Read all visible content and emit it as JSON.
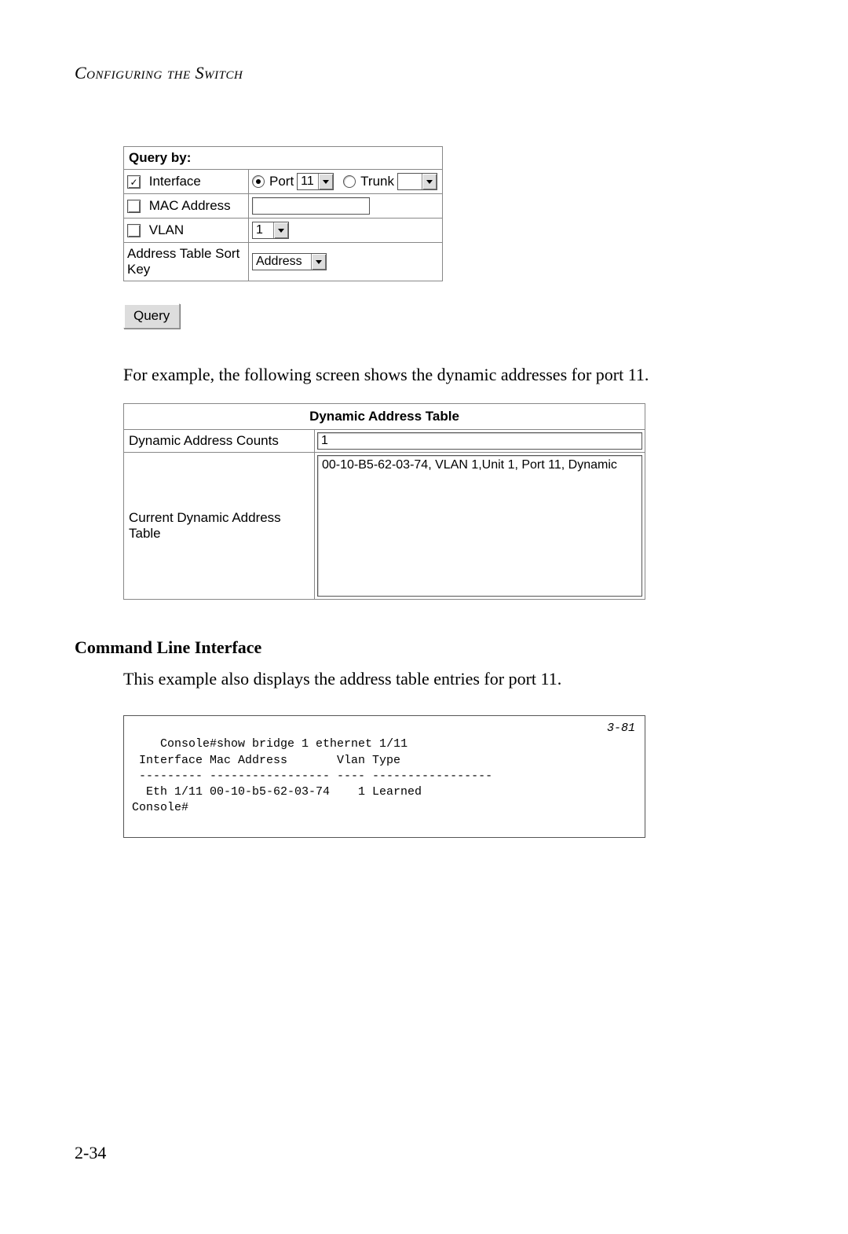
{
  "header": {
    "title": "Configuring the Switch"
  },
  "query": {
    "heading": "Query by:",
    "rows": {
      "interface": {
        "label": "Interface",
        "checked": true,
        "port_label": "Port",
        "port_value": "11",
        "port_selected": true,
        "trunk_label": "Trunk",
        "trunk_value": "",
        "trunk_selected": false
      },
      "mac": {
        "label": "MAC Address",
        "checked": false,
        "value": ""
      },
      "vlan": {
        "label": "VLAN",
        "checked": false,
        "value": "1"
      },
      "sortkey": {
        "label": "Address Table Sort Key",
        "value": "Address"
      }
    },
    "button": "Query"
  },
  "paragraph1": "For example, the following screen shows the dynamic addresses for port 11.",
  "dynamic_table": {
    "title": "Dynamic Address Table",
    "counts_label": "Dynamic Address Counts",
    "counts_value": "1",
    "current_label": "Current Dynamic Address Table",
    "entries": [
      "00-10-B5-62-03-74, VLAN 1,Unit 1, Port 11, Dynamic"
    ]
  },
  "cli": {
    "heading": "Command Line Interface",
    "intro": "This example also displays the address table entries for port 11.",
    "ref": "3-81",
    "lines": "Console#show bridge 1 ethernet 1/11\n Interface Mac Address       Vlan Type\n --------- ----------------- ---- -----------------\n  Eth 1/11 00-10-b5-62-03-74    1 Learned\nConsole#"
  },
  "page_number": "2-34"
}
